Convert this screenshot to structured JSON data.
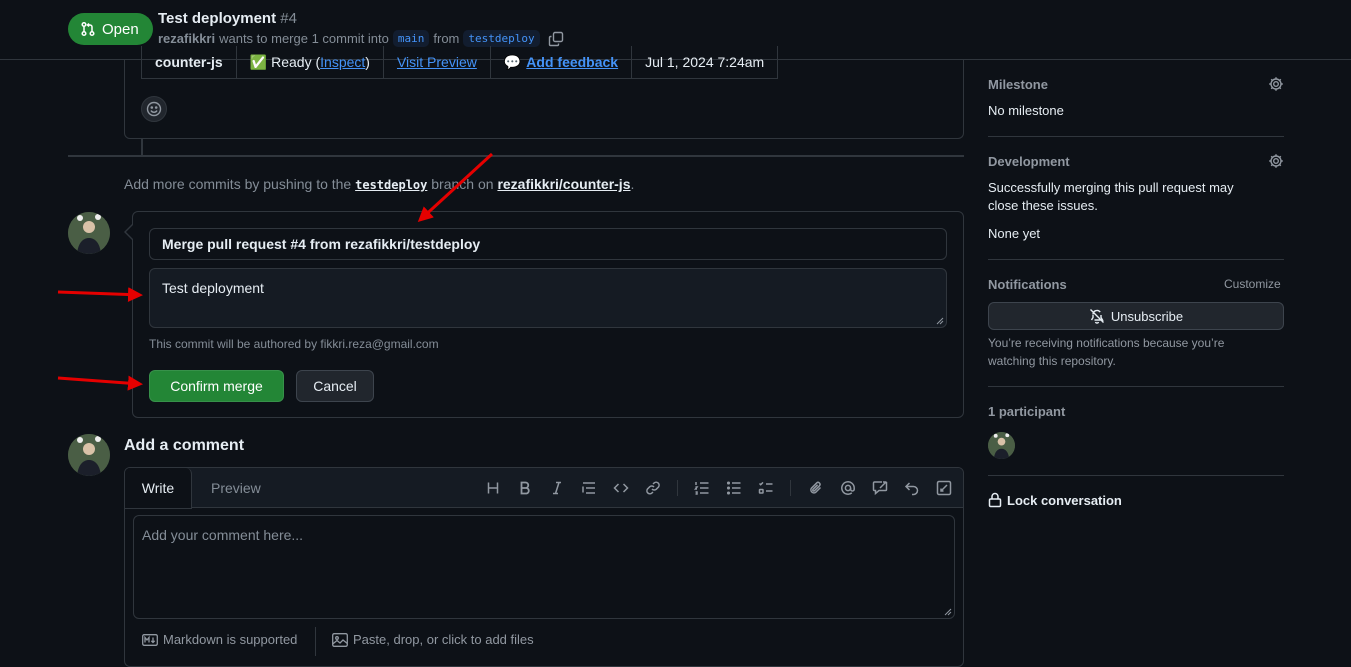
{
  "header": {
    "state": "Open",
    "title": "Test deployment",
    "number": "#4",
    "author": "rezafikkri",
    "merge_text": "wants to merge 1 commit into",
    "base_branch": "main",
    "from_text": "from",
    "head_branch": "testdeploy"
  },
  "deployment": {
    "name": "counter-js",
    "status_emoji": "✅",
    "status_prefix": "Ready (",
    "inspect": "Inspect",
    "status_suffix": ")",
    "preview": "Visit Preview",
    "feedback_emoji": "💬",
    "feedback": "Add feedback",
    "updated": "Jul 1, 2024 7:24am"
  },
  "timeline": {
    "add_commits_prefix": "Add more commits by pushing to the",
    "branch": "testdeploy",
    "branch_on": "branch on",
    "repo": "rezafikkri/counter-js",
    "period": "."
  },
  "merge": {
    "commit_title": "Merge pull request #4 from rezafikkri/testdeploy",
    "commit_body": "Test deployment",
    "author_note": "This commit will be authored by fikkri.reza@gmail.com",
    "confirm_label": "Confirm merge",
    "cancel_label": "Cancel"
  },
  "comment": {
    "title": "Add a comment",
    "tab_write": "Write",
    "tab_preview": "Preview",
    "placeholder": "Add your comment here...",
    "markdown_note": "Markdown is supported",
    "attach_note": "Paste, drop, or click to add files"
  },
  "sidebar": {
    "milestone_label": "Milestone",
    "milestone_value": "No milestone",
    "development_label": "Development",
    "development_text": "Successfully merging this pull request may close these issues.",
    "development_value": "None yet",
    "notifications_label": "Notifications",
    "customize": "Customize",
    "unsubscribe": "Unsubscribe",
    "notifications_text": "You’re receiving notifications because you’re watching this repository.",
    "participants_label": "1 participant",
    "lock": "Lock conversation"
  },
  "colors": {
    "background": "#0d1117",
    "accent_green": "#238636",
    "link_blue": "#4493f8",
    "border": "#30363d",
    "annotation_red": "#e50000"
  },
  "icons": {
    "state": "git-pull-request-icon",
    "copy": "copy-icon",
    "gear": "gear-icon",
    "bell_slash": "bell-slash-icon",
    "lock": "lock-icon",
    "smiley": "smiley-icon"
  }
}
